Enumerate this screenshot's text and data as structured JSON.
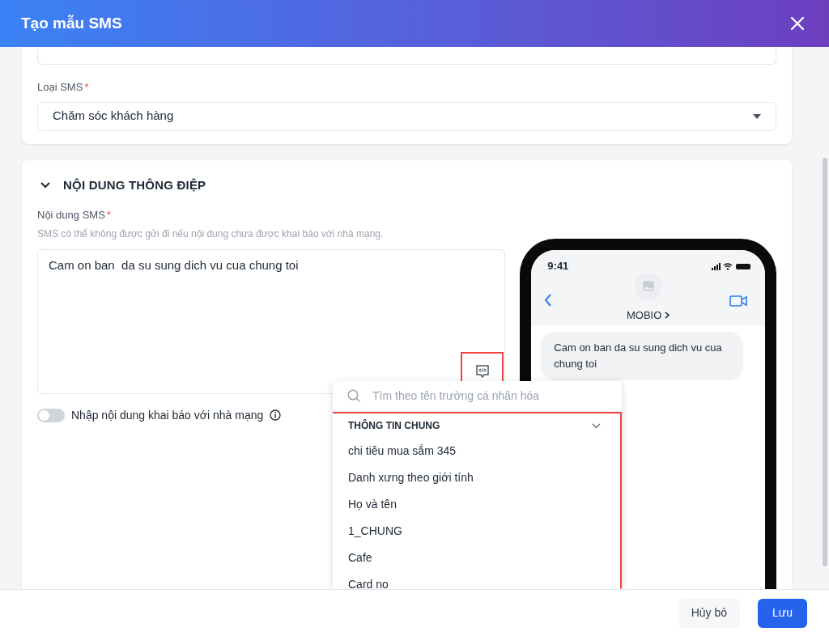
{
  "dialog": {
    "title": "Tạo mẫu SMS"
  },
  "sms_type": {
    "label": "Loại SMS",
    "required_mark": "*",
    "value": "Chăm sóc khách hàng"
  },
  "message_section": {
    "title": "NỘI DUNG THÔNG ĐIỆP",
    "expanded": true,
    "content": {
      "label": "Nội dung SMS",
      "required_mark": "*",
      "hint": "SMS có thể không được gửi đi nếu nội dung chưa được khai báo với nhà mạng.",
      "value": "Cam on ban  da su sung dich vu cua chung toi",
      "variable_button_highlighted": true
    },
    "carrier_toggle": {
      "label": "Nhập nội dung khai báo với nhà mạng",
      "on": false
    },
    "preview": {
      "time": "9:41",
      "contact": "MOBIO",
      "message": "Cam on ban da su sung dich vu cua chung toi"
    }
  },
  "personalization_menu": {
    "search_placeholder": "Tìm theo tên trường cá nhân hóa",
    "highlighted": true,
    "groups": [
      {
        "title": "THÔNG TIN CHUNG",
        "expanded": true,
        "items": [
          "chi tiêu mua sắm 345",
          "Danh xưng theo giới tính",
          "Họ và tên",
          "1_CHUNG",
          "Cafe",
          "Card no"
        ]
      }
    ]
  },
  "footer": {
    "buttons": [
      {
        "label": "Hủy bỏ",
        "kind": "secondary"
      },
      {
        "label": "Lưu",
        "kind": "primary"
      }
    ]
  }
}
